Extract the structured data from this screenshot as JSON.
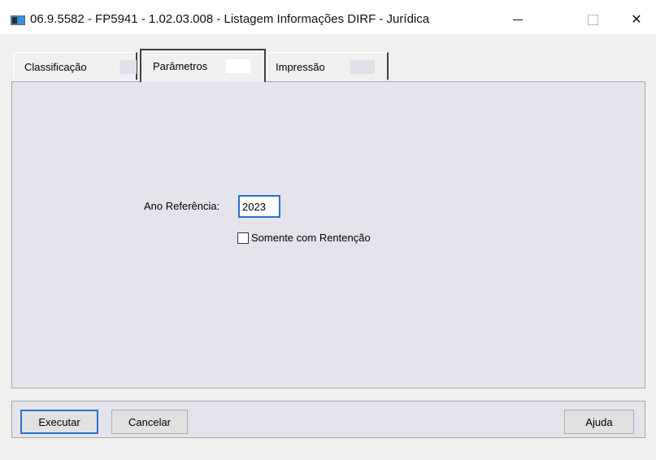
{
  "window": {
    "title": "06.9.5582 - FP5941 - 1.02.03.008 - Listagem Informações DIRF - Jurídica",
    "minimize_glyph": "",
    "close_glyph": "✕"
  },
  "tabs": [
    {
      "label": "Classificação",
      "active": false
    },
    {
      "label": "Parâmetros",
      "active": true
    },
    {
      "label": "Impressão",
      "active": false
    }
  ],
  "form": {
    "year_label": "Ano Referência:",
    "year_value": "2023",
    "retention_label": "Somente com Rentenção",
    "retention_checked": false
  },
  "buttons": {
    "execute": "Executar",
    "cancel": "Cancelar",
    "help": "Ajuda"
  },
  "colors": {
    "accent": "#2b6fd1",
    "panel_bg": "#e5e4ec",
    "window_bg": "#f0f0f0"
  }
}
